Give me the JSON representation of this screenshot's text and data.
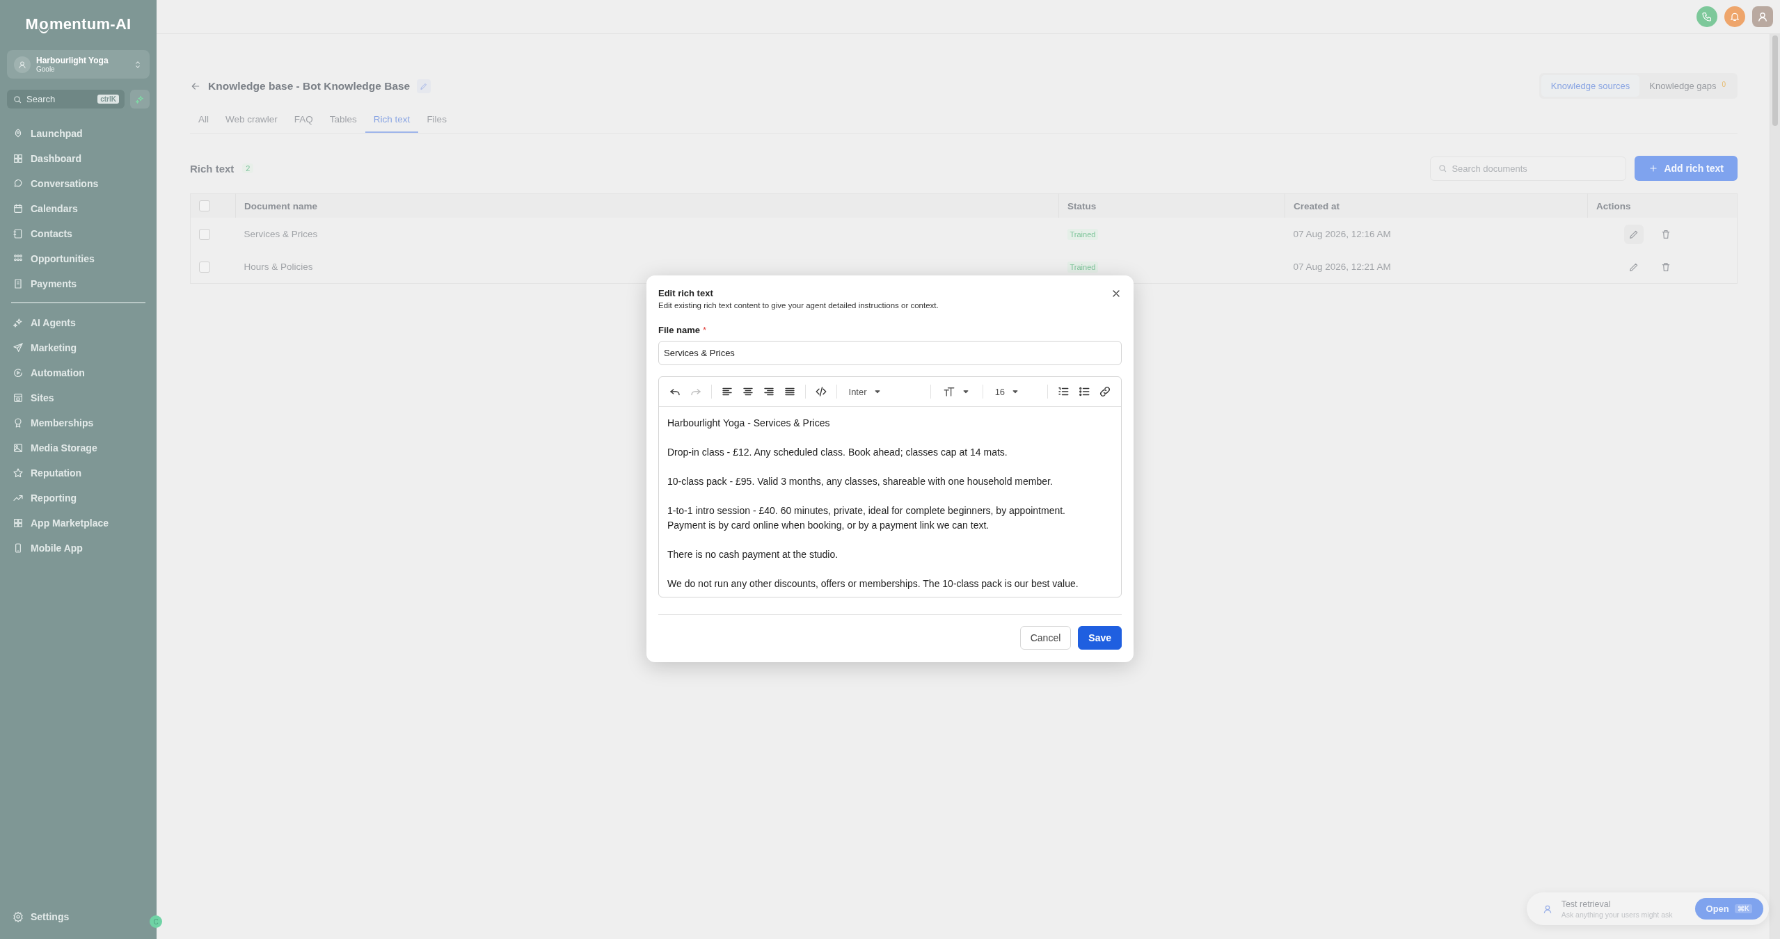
{
  "sidebar": {
    "logo": "Momentum-AI",
    "account": {
      "name": "Harbourlight Yoga",
      "subtitle": "Goole"
    },
    "search": {
      "placeholder": "Search",
      "shortcut": "ctrlK"
    },
    "nav_groups": [
      [
        "Launchpad",
        "Dashboard",
        "Conversations",
        "Calendars",
        "Contacts",
        "Opportunities",
        "Payments"
      ],
      [
        "AI Agents",
        "Marketing",
        "Automation",
        "Sites",
        "Memberships",
        "Media Storage",
        "Reputation",
        "Reporting",
        "App Marketplace",
        "Mobile App"
      ]
    ],
    "settings": "Settings",
    "badge": "C"
  },
  "header": {
    "title": "Knowledge base - Bot Knowledge Base",
    "views": [
      {
        "label": "Knowledge sources",
        "selected": true
      },
      {
        "label": "Knowledge gaps",
        "count": "0",
        "selected": false
      }
    ],
    "tabs": [
      {
        "label": "All",
        "selected": false
      },
      {
        "label": "Web crawler",
        "selected": false
      },
      {
        "label": "FAQ",
        "selected": false
      },
      {
        "label": "Tables",
        "selected": false
      },
      {
        "label": "Rich text",
        "selected": true
      },
      {
        "label": "Files",
        "selected": false
      }
    ]
  },
  "section": {
    "title": "Rich text",
    "count": "2",
    "search": {
      "placeholder": "Search documents"
    },
    "add_button": "Add rich text"
  },
  "table": {
    "columns": [
      "Document name",
      "Status",
      "Created at",
      "Actions"
    ],
    "all_checked": false,
    "rows": [
      {
        "name": "Services & Prices",
        "status": "Trained",
        "created": "07 Aug 2026, 12:16 AM",
        "checked": false
      },
      {
        "name": "Hours & Policies",
        "status": "Trained",
        "created": "07 Aug 2026, 12:21 AM",
        "checked": false
      }
    ]
  },
  "modal": {
    "title": "Edit rich text",
    "subtitle": "Edit existing rich text content to give your agent detailed instructions or context.",
    "field_label": "File name",
    "required_mark": "*",
    "file_name": "Services & Prices",
    "toolbar": {
      "undo_disabled": false,
      "redo_disabled": true,
      "font": "Inter",
      "size": "16"
    },
    "paragraphs": [
      [
        "Harbourlight Yoga - Services & Prices"
      ],
      [
        "Drop-in class - £12. Any scheduled class. Book ahead; classes cap at 14 mats."
      ],
      [
        "10-class pack - £95. Valid 3 months, any classes, shareable with one household member."
      ],
      [
        "1-to-1 intro session - £40. 60 minutes, private, ideal for complete beginners, by appointment.",
        "Payment is by card online when booking, or by a payment link we can text."
      ],
      [
        "There is no cash payment at the studio."
      ],
      [
        "We do not run any other discounts, offers or memberships. The 10-class pack is our best value."
      ]
    ],
    "buttons": [
      {
        "label": "Cancel",
        "kind": "secondary"
      },
      {
        "label": "Save",
        "kind": "primary"
      }
    ]
  },
  "widget": {
    "title": "Test retrieval",
    "subtitle": "Ask anything your users might ask",
    "button": "Open",
    "shortcut": "⌘K"
  }
}
